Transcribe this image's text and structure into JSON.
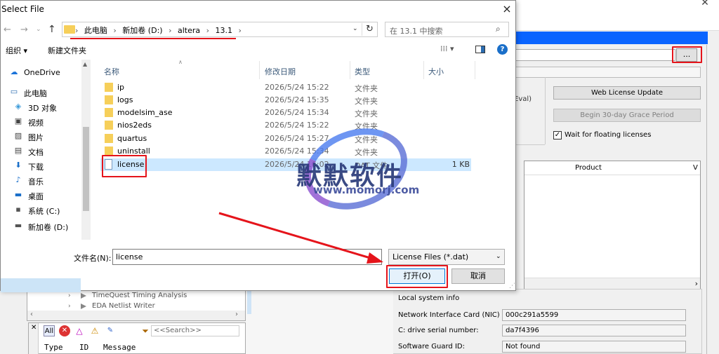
{
  "dialog": {
    "title": "Select File",
    "close": "×",
    "nav": {
      "back": "←",
      "forward": "→",
      "recent": "⌄",
      "up": "↑"
    },
    "breadcrumb": [
      "此电脑",
      "新加卷 (D:)",
      "altera",
      "13.1"
    ],
    "crumb_sep": "›",
    "address_dropdown": "⌄",
    "refresh": "↻",
    "search_placeholder": "在 13.1 中搜索",
    "search_icon": "⌕",
    "toolbar": {
      "organize": "组织 ▾",
      "new_folder": "新建文件夹",
      "view": "⁞⁞⁞ ▾",
      "help": "?"
    },
    "sidebar": [
      {
        "icon": "☁",
        "label": "OneDrive"
      },
      {
        "icon": "▭",
        "label": "此电脑"
      },
      {
        "icon": "◈",
        "label": "3D 对象"
      },
      {
        "icon": "▣",
        "label": "视频"
      },
      {
        "icon": "▨",
        "label": "图片"
      },
      {
        "icon": "▤",
        "label": "文档"
      },
      {
        "icon": "⬇",
        "label": "下载"
      },
      {
        "icon": "♪",
        "label": "音乐"
      },
      {
        "icon": "▬",
        "label": "桌面"
      },
      {
        "icon": "▪",
        "label": "系统 (C:)"
      },
      {
        "icon": "▬",
        "label": "新加卷 (D:)"
      }
    ],
    "columns": {
      "name": "名称",
      "date": "修改日期",
      "type": "类型",
      "size": "大小"
    },
    "files": [
      {
        "name": "ip",
        "date": "2026/5/24 15:22",
        "type": "文件夹",
        "size": "",
        "kind": "folder"
      },
      {
        "name": "logs",
        "date": "2026/5/24 15:35",
        "type": "文件夹",
        "size": "",
        "kind": "folder"
      },
      {
        "name": "modelsim_ase",
        "date": "2026/5/24 15:34",
        "type": "文件夹",
        "size": "",
        "kind": "folder"
      },
      {
        "name": "nios2eds",
        "date": "2026/5/24 15:22",
        "type": "文件夹",
        "size": "",
        "kind": "folder"
      },
      {
        "name": "quartus",
        "date": "2026/5/24 15:27",
        "type": "文件夹",
        "size": "",
        "kind": "folder"
      },
      {
        "name": "uninstall",
        "date": "2026/5/24 15:34",
        "type": "文件夹",
        "size": "",
        "kind": "folder"
      },
      {
        "name": "license",
        "date": "2026/5/24 16:02",
        "type": "DAT 文件",
        "size": "1 KB",
        "kind": "file"
      }
    ],
    "filename_label": "文件名(N):",
    "filename_value": "license",
    "filetype_value": "License Files (*.dat)",
    "open_button": "打开(O)",
    "cancel_button": "取消",
    "accent": "#0078d7",
    "selection_color": "#cce8ff"
  },
  "watermark": {
    "text": "默默软件",
    "url": "www.momorj.com"
  },
  "license_window": {
    "browse_button": "...",
    "eval_label": "Eval)",
    "web_license_update": "Web License Update",
    "begin_grace": "Begin 30-day Grace Period",
    "wait_floating": "Wait for floating licenses",
    "wait_checked": true,
    "table_product": "Product",
    "table_v": "V",
    "local_system_info": "Local system info",
    "nic_label": "Network Interface Card (NIC) ID:",
    "nic_value": "000c291a5599",
    "drive_label": "C: drive serial number:",
    "drive_value": "da7f4396",
    "guard_label": "Software Guard ID:",
    "guard_value": "Not found",
    "title_bar_color": "#0a64ff"
  },
  "quartus": {
    "tasks": [
      "TimeQuest Timing Analysis",
      "EDA Netlist Writer"
    ],
    "filter_all": "All",
    "search_placeholder": "<<Search>>",
    "msg_headers": {
      "type": "Type",
      "id": "ID",
      "message": "Message"
    }
  },
  "annotation_color": "#e5141b"
}
